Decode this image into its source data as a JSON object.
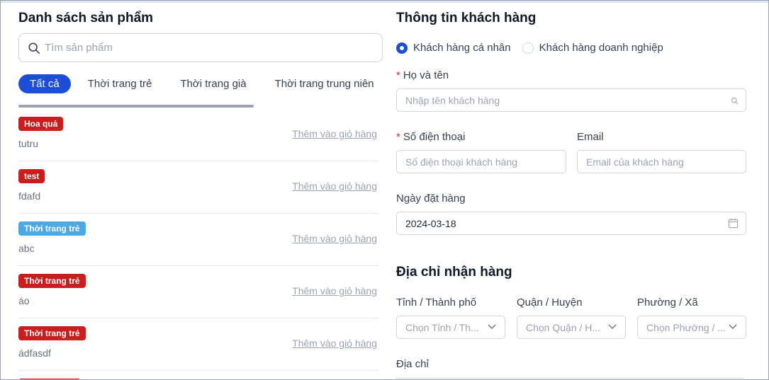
{
  "products": {
    "title": "Danh sách sản phẩm",
    "search_placeholder": "Tìm sản phẩm",
    "tabs": [
      {
        "label": "Tất cả",
        "active": true
      },
      {
        "label": "Thời trang trẻ",
        "active": false
      },
      {
        "label": "Thời trang già",
        "active": false
      },
      {
        "label": "Thời trang trung niên",
        "active": false
      }
    ],
    "items": [
      {
        "category": "Hoa quả",
        "name": "tutru",
        "badge_color": "#c81e1e",
        "add_label": "Thêm vào giỏ hàng"
      },
      {
        "category": "test",
        "name": "fdafd",
        "badge_color": "#c81e1e",
        "add_label": "Thêm vào giỏ hàng"
      },
      {
        "category": "Thời trang trẻ",
        "name": "abc",
        "badge_color": "#4ea8e6",
        "add_label": "Thêm vào giỏ hàng"
      },
      {
        "category": "Thời trang trẻ",
        "name": "áo",
        "badge_color": "#c81e1e",
        "add_label": "Thêm vào giỏ hàng"
      },
      {
        "category": "Thời trang trẻ",
        "name": "ádfasdf",
        "badge_color": "#c81e1e",
        "add_label": "Thêm vào giỏ hàng"
      }
    ]
  },
  "customer": {
    "title": "Thông tin khách hàng",
    "type_options": [
      {
        "label": "Khách hàng cá nhân",
        "checked": true
      },
      {
        "label": "Khách hàng doanh nghiệp",
        "checked": false
      }
    ],
    "full_name_label": "Họ và tên",
    "full_name_placeholder": "Nhập tên khách hàng",
    "phone_label": "Số điện thoại",
    "phone_placeholder": "Số điện thoại khách hàng",
    "email_label": "Email",
    "email_placeholder": "Email của khách hàng",
    "order_date_label": "Ngày đặt hàng",
    "order_date_value": "2024-03-18"
  },
  "address": {
    "title": "Địa chỉ nhận hàng",
    "province_label": "Tỉnh / Thành phố",
    "province_placeholder": "Chọn Tỉnh / Th...",
    "district_label": "Quận / Huyện",
    "district_placeholder": "Chọn Quận / H...",
    "ward_label": "Phường / Xã",
    "ward_placeholder": "Chọn Phường / ...",
    "address_label": "Địa chỉ"
  },
  "colors": {
    "accent": "#1d4ed8",
    "required": "#dc2626",
    "badge_red": "#c81e1e",
    "badge_blue": "#4ea8e6"
  },
  "icons": [
    "search-icon",
    "calendar-icon",
    "chevron-down-icon"
  ]
}
